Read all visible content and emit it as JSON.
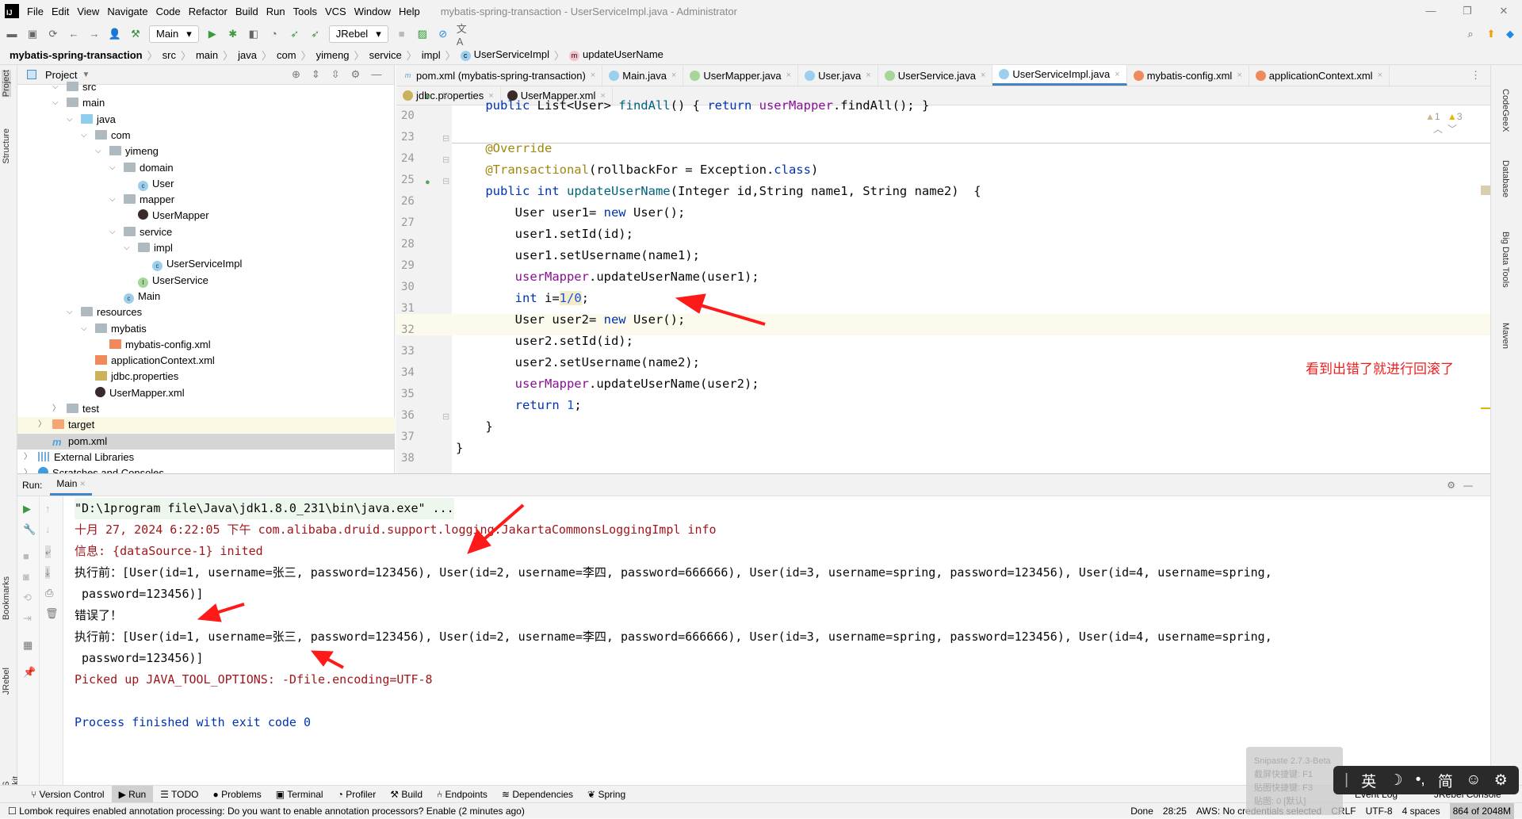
{
  "window": {
    "title": "mybatis-spring-transaction - UserServiceImpl.java - Administrator",
    "logo": "IJ",
    "controls": [
      "—",
      "❐",
      "✕"
    ]
  },
  "menu": [
    "File",
    "Edit",
    "View",
    "Navigate",
    "Code",
    "Refactor",
    "Build",
    "Run",
    "Tools",
    "VCS",
    "Window",
    "Help"
  ],
  "toolbar": {
    "run_config": "Main",
    "jrebel": "JRebel"
  },
  "breadcrumb": [
    "mybatis-spring-transaction",
    "src",
    "main",
    "java",
    "com",
    "yimeng",
    "service",
    "impl",
    "UserServiceImpl",
    "updateUserName"
  ],
  "project": {
    "title": "Project",
    "tree": [
      {
        "label": "src",
        "depth": 2,
        "type": "folder",
        "open": true
      },
      {
        "label": "main",
        "depth": 2,
        "type": "folder",
        "open": true
      },
      {
        "label": "java",
        "depth": 3,
        "type": "src",
        "open": true
      },
      {
        "label": "com",
        "depth": 4,
        "type": "pkg",
        "open": true
      },
      {
        "label": "yimeng",
        "depth": 5,
        "type": "pkg",
        "open": true
      },
      {
        "label": "domain",
        "depth": 6,
        "type": "pkg",
        "open": true
      },
      {
        "label": "User",
        "depth": 7,
        "type": "class"
      },
      {
        "label": "mapper",
        "depth": 6,
        "type": "pkg",
        "open": true
      },
      {
        "label": "UserMapper",
        "depth": 7,
        "type": "mybatis"
      },
      {
        "label": "service",
        "depth": 6,
        "type": "pkg",
        "open": true
      },
      {
        "label": "impl",
        "depth": 7,
        "type": "pkg",
        "open": true
      },
      {
        "label": "UserServiceImpl",
        "depth": 8,
        "type": "class"
      },
      {
        "label": "UserService",
        "depth": 7,
        "type": "interface"
      },
      {
        "label": "Main",
        "depth": 6,
        "type": "class"
      },
      {
        "label": "resources",
        "depth": 3,
        "type": "res",
        "open": true
      },
      {
        "label": "mybatis",
        "depth": 4,
        "type": "folder",
        "open": true
      },
      {
        "label": "mybatis-config.xml",
        "depth": 5,
        "type": "xml"
      },
      {
        "label": "applicationContext.xml",
        "depth": 4,
        "type": "xml"
      },
      {
        "label": "jdbc.properties",
        "depth": 4,
        "type": "props"
      },
      {
        "label": "UserMapper.xml",
        "depth": 4,
        "type": "mybatis"
      },
      {
        "label": "test",
        "depth": 2,
        "type": "folder",
        "open": false
      },
      {
        "label": "target",
        "depth": 1,
        "type": "target",
        "open": false,
        "highlight": true
      },
      {
        "label": "pom.xml",
        "depth": 1,
        "type": "maven",
        "selected": true
      },
      {
        "label": "External Libraries",
        "depth": 0,
        "type": "libs",
        "open": false
      },
      {
        "label": "Scratches and Consoles",
        "depth": 0,
        "type": "scratch",
        "open": false
      }
    ]
  },
  "left_strip": [
    "Project",
    "Structure",
    "Bookmarks",
    "JRebel",
    "AWS Toolkit"
  ],
  "right_strip": [
    "CodeGeeX",
    "Database",
    "Big Data Tools",
    "Maven"
  ],
  "editor": {
    "tabs_row1": [
      {
        "label": "pom.xml (mybatis-spring-transaction)",
        "icon": "m"
      },
      {
        "label": "Main.java",
        "icon": "c"
      },
      {
        "label": "UserMapper.java",
        "icon": "i"
      },
      {
        "label": "User.java",
        "icon": "c"
      },
      {
        "label": "UserService.java",
        "icon": "i"
      },
      {
        "label": "UserServiceImpl.java",
        "icon": "c",
        "active": true
      },
      {
        "label": "mybatis-config.xml",
        "icon": "x"
      },
      {
        "label": "applicationContext.xml",
        "icon": "x"
      }
    ],
    "tabs_row2": [
      {
        "label": "jdbc.properties",
        "icon": "p"
      },
      {
        "label": "UserMapper.xml",
        "icon": "b"
      }
    ],
    "inspections": {
      "weak_warnings": "1",
      "warnings": "3"
    },
    "lines": [
      {
        "n": "20",
        "seg": [
          [
            "    "
          ],
          [
            "public ",
            "kw"
          ],
          [
            "List<User> "
          ],
          [
            "findAll",
            "mt"
          ],
          [
            "() { "
          ],
          [
            "return ",
            "kw"
          ],
          [
            "userMapper",
            "fd"
          ],
          [
            ".findAll(); }"
          ]
        ]
      },
      {
        "n": "23",
        "seg": [
          [
            ""
          ]
        ]
      },
      {
        "n": "24",
        "seg": [
          [
            "    "
          ],
          [
            "@Override",
            "an"
          ]
        ]
      },
      {
        "n": "25",
        "seg": [
          [
            "    "
          ],
          [
            "@Transactional",
            "an"
          ],
          [
            "(rollbackFor = Exception."
          ],
          [
            "class",
            "kw"
          ],
          [
            ")"
          ]
        ]
      },
      {
        "n": "26",
        "seg": [
          [
            "    "
          ],
          [
            "public int ",
            "kw"
          ],
          [
            "updateUserName",
            "mt"
          ],
          [
            "(Integer id,String name1, String name2)  {"
          ]
        ]
      },
      {
        "n": "27",
        "seg": [
          [
            "        User user1= "
          ],
          [
            "new ",
            "kw"
          ],
          [
            "User();"
          ]
        ]
      },
      {
        "n": "28",
        "seg": [
          [
            "        user1.setId(id);"
          ]
        ]
      },
      {
        "n": "29",
        "seg": [
          [
            "        user1.setUsername(name1);"
          ]
        ]
      },
      {
        "n": "30",
        "seg": [
          [
            "        "
          ],
          [
            "userMapper",
            "fd"
          ],
          [
            ".updateUserName(user1);"
          ]
        ]
      },
      {
        "n": "31",
        "seg": [
          [
            "        "
          ],
          [
            "int ",
            "kw"
          ],
          [
            "i="
          ],
          [
            "1/0",
            "nm hl"
          ],
          [
            ";"
          ]
        ]
      },
      {
        "n": "32",
        "seg": [
          [
            "        User user2= "
          ],
          [
            "new ",
            "kw"
          ],
          [
            "User();"
          ]
        ]
      },
      {
        "n": "33",
        "seg": [
          [
            "        user2.setId(id);"
          ]
        ]
      },
      {
        "n": "34",
        "seg": [
          [
            "        user2.setUsername(name2);"
          ]
        ]
      },
      {
        "n": "35",
        "seg": [
          [
            "        "
          ],
          [
            "userMapper",
            "fd"
          ],
          [
            ".updateUserName(user2);"
          ]
        ]
      },
      {
        "n": "36",
        "seg": [
          [
            "        "
          ],
          [
            "return ",
            "kw"
          ],
          [
            "1",
            "nm"
          ],
          [
            ";"
          ]
        ]
      },
      {
        "n": "37",
        "seg": [
          [
            "    }"
          ]
        ]
      },
      {
        "n": "38",
        "seg": [
          [
            "}"
          ]
        ]
      }
    ],
    "annotation": "看到出错了就进行回滚了"
  },
  "run": {
    "label": "Run:",
    "tab": "Main",
    "console": [
      {
        "text": "\"D:\\1program file\\Java\\jdk1.8.0_231\\bin\\java.exe\" ...",
        "style": "cmd"
      },
      {
        "text": "十月 27, 2024 6:22:05 下午 com.alibaba.druid.support.logging.JakartaCommonsLoggingImpl info",
        "style": "err"
      },
      {
        "text": "信息: {dataSource-1} inited",
        "style": "err"
      },
      {
        "text": "执行前：[User(id=1, username=张三, password=123456), User(id=2, username=李四, password=666666), User(id=3, username=spring, password=123456), User(id=4, username=spring,",
        "style": "out"
      },
      {
        "text": " password=123456)]",
        "style": "out"
      },
      {
        "text": "错误了！",
        "style": "out"
      },
      {
        "text": "执行前：[User(id=1, username=张三, password=123456), User(id=2, username=李四, password=666666), User(id=3, username=spring, password=123456), User(id=4, username=spring,",
        "style": "out"
      },
      {
        "text": " password=123456)]",
        "style": "out"
      },
      {
        "text": "Picked up JAVA_TOOL_OPTIONS: -Dfile.encoding=UTF-8",
        "style": "err"
      },
      {
        "text": "",
        "style": "out"
      },
      {
        "text": "Process finished with exit code 0",
        "style": "fin"
      }
    ]
  },
  "tool_windows": [
    "Version Control",
    "Run",
    "TODO",
    "Problems",
    "Terminal",
    "Profiler",
    "Build",
    "Endpoints",
    "Dependencies",
    "Spring"
  ],
  "tool_windows_right": [
    "Event Log",
    "JRebel Console"
  ],
  "status": {
    "message": "Lombok requires enabled annotation processing: Do you want to enable annotation processors? Enable (2 minutes ago)",
    "items": [
      "Done",
      "28:25",
      "AWS: No credentials selected",
      "CRLF",
      "UTF-8",
      "4 spaces",
      "864 of 2048M"
    ]
  },
  "snipaste": [
    "Snipaste 2.7.3-Beta",
    "截屏快捷键: F1",
    "贴图快捷键: F3",
    "贴图: 0 [默认]"
  ],
  "ime": [
    "英",
    "☽",
    "•,",
    "简",
    "☺",
    "⚙"
  ],
  "colors": {
    "keyword": "#0033b3",
    "annotation": "#9e880d",
    "field": "#871094",
    "method": "#00627a",
    "number": "#1750eb",
    "console_error": "#a0161a",
    "arrow": "#ff1a1a",
    "accent": "#4083c9"
  }
}
